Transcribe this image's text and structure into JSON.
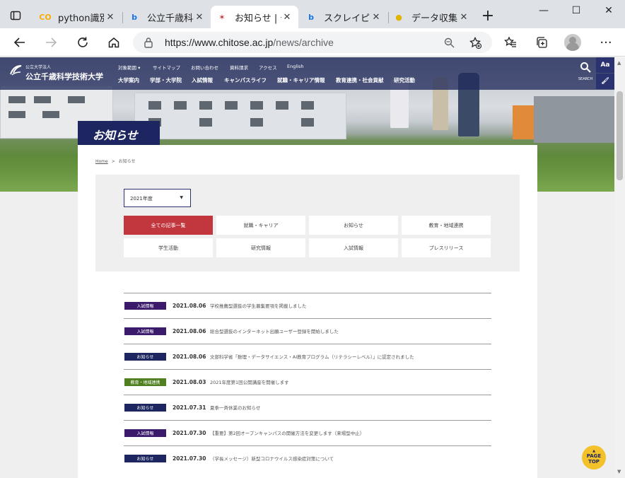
{
  "browser": {
    "tabs": [
      {
        "title": "python識別",
        "favicon": "CO",
        "favicon_color": "#f9ab00"
      },
      {
        "title": "公立千歳科学",
        "favicon": "b",
        "favicon_color": "#1a73e8"
      },
      {
        "title": "お知らせ | 公",
        "favicon": "✶",
        "favicon_color": "#c2373d",
        "active": true
      },
      {
        "title": "スクレイピング",
        "favicon": "b",
        "favicon_color": "#1a73e8"
      },
      {
        "title": "データ収集を",
        "favicon": "●",
        "favicon_color": "#e0b400"
      }
    ],
    "tab_close": "✕",
    "new_tab": "+",
    "window": {
      "minimize": "—",
      "maximize": "☐",
      "close": "✕"
    },
    "address": {
      "host": "https://www.chitose.ac.jp",
      "path": "/news/archive"
    },
    "more": "···"
  },
  "site": {
    "logo_small": "公立大学法人",
    "logo_name": "公立千歳科学技術大学",
    "subnav": [
      {
        "label": "対象範囲 ▾"
      },
      {
        "label": "サイトマップ"
      },
      {
        "label": "お問い合わせ"
      },
      {
        "label": "資料請求"
      },
      {
        "label": "アクセス"
      },
      {
        "label": "English"
      }
    ],
    "mainnav": [
      {
        "label": "大学案内"
      },
      {
        "label": "学部・大学院"
      },
      {
        "label": "入試情報"
      },
      {
        "label": "キャンパスライフ"
      },
      {
        "label": "就職・キャリア情報"
      },
      {
        "label": "教育連携・社会貢献"
      },
      {
        "label": "研究活動"
      }
    ],
    "search_label": "SEARCH",
    "font_tool": "Aa",
    "color_tool": "🖌"
  },
  "page": {
    "title": "お知らせ",
    "breadcrumb": {
      "home": "Home",
      "sep": ">",
      "current": "お知らせ"
    },
    "year_select": "2021年度",
    "categories": [
      {
        "label": "全ての記事一覧",
        "active": true
      },
      {
        "label": "就職・キャリア"
      },
      {
        "label": "お知らせ"
      },
      {
        "label": "教育・地域連携"
      },
      {
        "label": "学生活動"
      },
      {
        "label": "研究情報"
      },
      {
        "label": "入試情報"
      },
      {
        "label": "プレスリリース"
      }
    ],
    "news": [
      {
        "tag": "入試情報",
        "tag_color": "#3b1a6b",
        "date": "2021.08.06",
        "text": "学校推薦型選抜の学生募集要項を掲載しました"
      },
      {
        "tag": "入試情報",
        "tag_color": "#3b1a6b",
        "date": "2021.08.06",
        "text": "総合型選抜のインターネット出願ユーザー登録を開始しました"
      },
      {
        "tag": "お知らせ",
        "tag_color": "#1d2660",
        "date": "2021.08.06",
        "text": "文部科学省「数理・データサイエンス・AI教育プログラム（リテラシーレベル）」に認定されました"
      },
      {
        "tag": "教育・地域連携",
        "tag_color": "#4f7f1f",
        "date": "2021.08.03",
        "text": "2021年度第1回公開講座を開催します"
      },
      {
        "tag": "お知らせ",
        "tag_color": "#1d2660",
        "date": "2021.07.31",
        "text": "夏季一斉休業のお知らせ"
      },
      {
        "tag": "入試情報",
        "tag_color": "#3b1a6b",
        "date": "2021.07.30",
        "text": "【重要】第2回オープンキャンパスの開催方法を変更します（来場型中止）"
      },
      {
        "tag": "お知らせ",
        "tag_color": "#1d2660",
        "date": "2021.07.30",
        "text": "（学長メッセージ）新型コロナウイルス感染症対策について"
      }
    ],
    "page_top": "PAGE TOP"
  }
}
